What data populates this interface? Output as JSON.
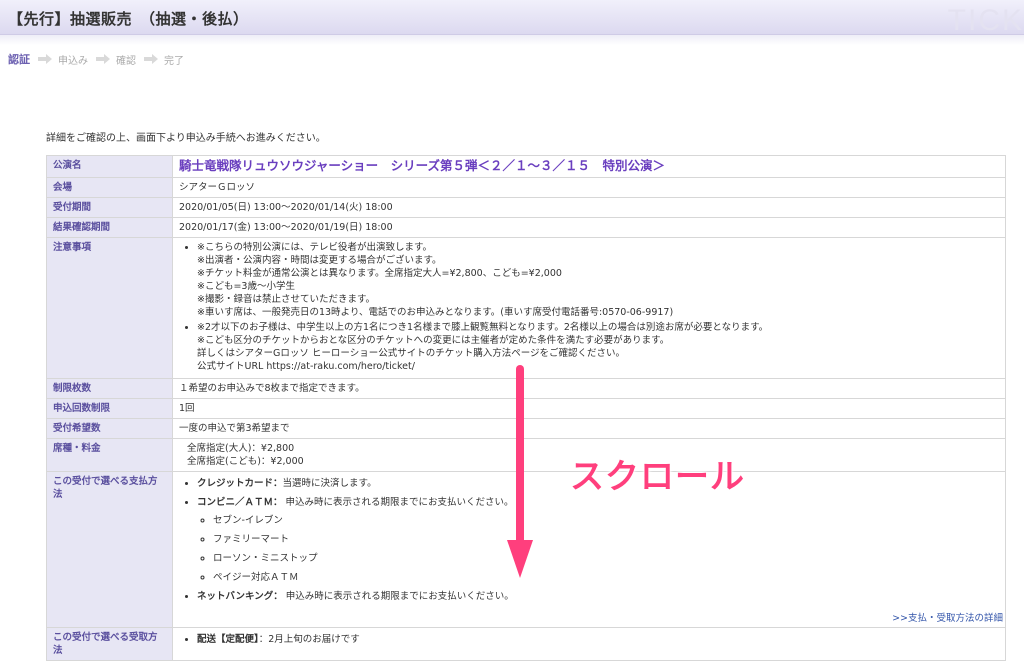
{
  "header": {
    "title": "【先行】抽選販売　（抽選・後払）",
    "brand": "TICK"
  },
  "steps": [
    {
      "label": "認証",
      "active": true
    },
    {
      "label": "申込み",
      "active": false
    },
    {
      "label": "確認",
      "active": false
    },
    {
      "label": "完了",
      "active": false
    }
  ],
  "intro": "詳細をご確認の上、画面下より申込み手続へお進みください。",
  "rows": {
    "event_name": {
      "label": "公演名",
      "value": "騎士竜戦隊リュウソウジャーショー　シリーズ第５弾＜２／１〜３／１５　特別公演＞"
    },
    "venue": {
      "label": "会場",
      "value": "シアターＧロッソ"
    },
    "period": {
      "label": "受付期間",
      "value": "2020/01/05(日) 13:00〜2020/01/14(火) 18:00"
    },
    "result": {
      "label": "結果確認期間",
      "value": "2020/01/17(金) 13:00〜2020/01/19(日) 18:00"
    },
    "notes": {
      "label": "注意事項",
      "item1": [
        "※こちらの特別公演には、テレビ役者が出演致します。",
        "※出演者・公演内容・時間は変更する場合がございます。",
        "※チケット料金が通常公演とは異なります。全席指定大人=¥2,800、こども=¥2,000",
        "※こども=3歳〜小学生",
        "※撮影・録音は禁止させていただきます。",
        "※車いす席は、一般発売日の13時より、電話でのお申込みとなります。(車いす席受付電話番号:0570-06-9917)"
      ],
      "item2": [
        "※2才以下のお子様は、中学生以上の方1名につき1名様まで膝上観覧無料となります。2名様以上の場合は別途お席が必要となります。",
        "※こども区分のチケットからおとな区分のチケットへの変更には主催者が定めた条件を満たす必要があります。",
        "詳しくはシアターGロッソ ヒーローショー公式サイトのチケット購入方法ページをご確認ください。",
        "公式サイトURL https://at-raku.com/hero/ticket/"
      ]
    },
    "limit": {
      "label": "制限枚数",
      "value": "１希望のお申込みで8枚まで指定できます。"
    },
    "apply_count": {
      "label": "申込回数制限",
      "value": "1回"
    },
    "wish": {
      "label": "受付希望数",
      "value": "一度の申込で第3希望まで"
    },
    "seat": {
      "label": "席種・料金",
      "line1": "全席指定(大人)：¥2,800",
      "line2": "全席指定(こども)：¥2,000"
    },
    "payment": {
      "label": "この受付で選べる支払方法",
      "credit_label": "クレジットカード：",
      "credit_text": "当選時に決済します。",
      "conv_label": "コンビニ／ＡＴＭ：",
      "conv_text": " 申込み時に表示される期限までにお支払いください。",
      "stores": [
        "セブン-イレブン",
        "ファミリーマート",
        "ローソン・ミニストップ",
        "ペイジー対応ＡＴＭ"
      ],
      "net_label": "ネットバンキング：",
      "net_text": " 申込み時に表示される期限までにお支払いください。",
      "detail_link": ">>支払・受取方法の詳細"
    },
    "receive": {
      "label": "この受付で選べる受取方法",
      "first_label": "配送【定配便】",
      "first_text": "：2月上旬のお届けです"
    }
  },
  "overlay": {
    "scroll_text": "スクロール",
    "arrow_color": "#ff3f7d"
  }
}
